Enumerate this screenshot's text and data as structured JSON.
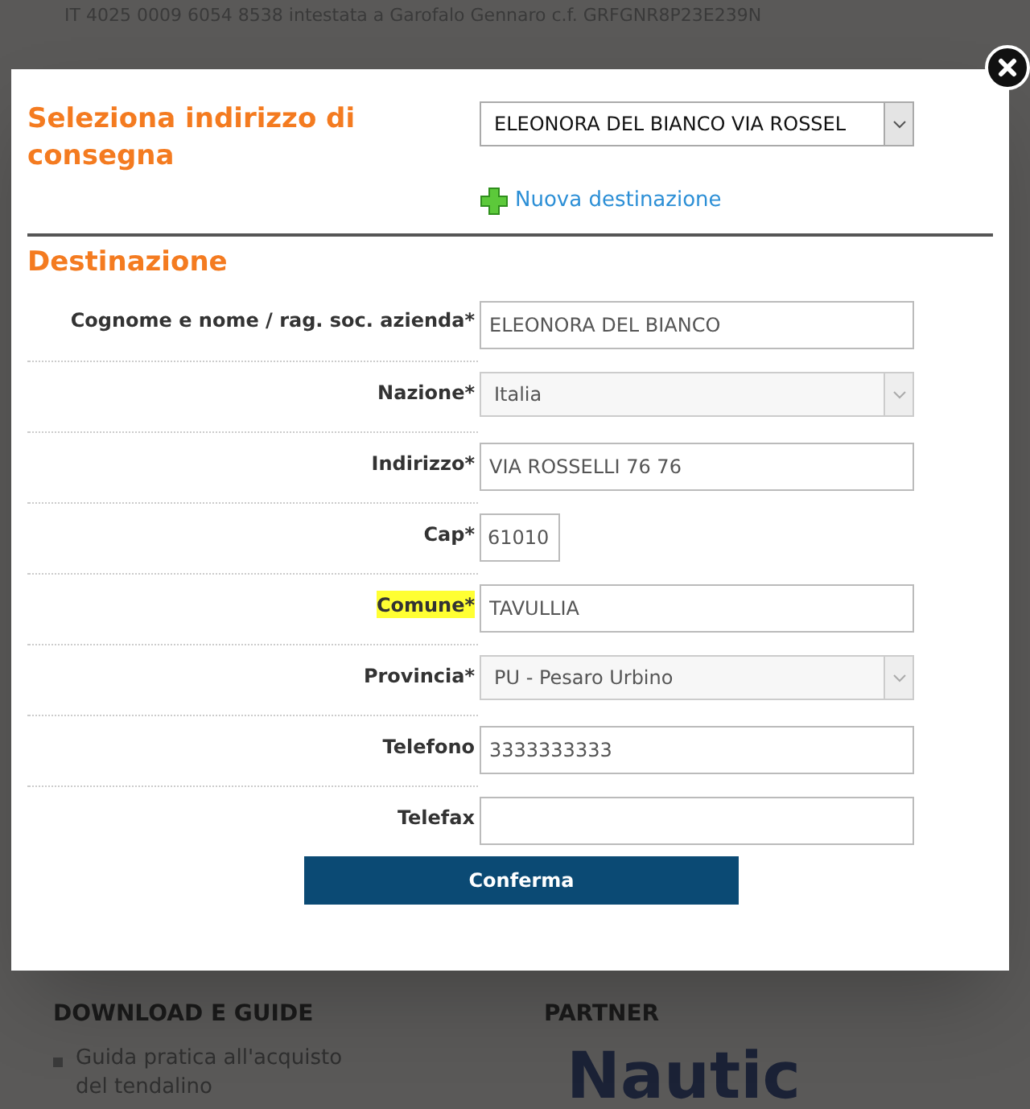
{
  "background": {
    "top_text": "IT 4025 0009 6054 8538 intestata a Garofalo Gennaro c.f. GRFGNR8P23E239N",
    "footer": [
      {
        "heading": "DOWNLOAD E GUIDE",
        "items": [
          "Guida pratica all'acquisto del tendalino"
        ]
      },
      {
        "heading": "PARTNER"
      }
    ],
    "partner_logo": "Nautic"
  },
  "modal": {
    "select_label": "Seleziona indirizzo di consegna",
    "address_select": {
      "value": "ELEONORA DEL BIANCO VIA ROSSEL"
    },
    "new_destination_link": "Nuova destinazione",
    "section_title": "Destinazione",
    "fields": [
      {
        "label": "Cognome e nome / rag. soc. azienda*",
        "kind": "text",
        "value": "ELEONORA DEL BIANCO",
        "highlighted": false
      },
      {
        "label": "Nazione*",
        "kind": "select",
        "value": "Italia",
        "highlighted": false
      },
      {
        "label": "Indirizzo*",
        "kind": "text",
        "value": "VIA ROSSELLI 76 76",
        "highlighted": false
      },
      {
        "label": "Cap*",
        "kind": "short",
        "value": "61010",
        "highlighted": false
      },
      {
        "label": "Comune*",
        "kind": "text",
        "value": "TAVULLIA",
        "highlighted": true
      },
      {
        "label": "Provincia*",
        "kind": "select",
        "value": "PU - Pesaro Urbino",
        "highlighted": false
      },
      {
        "label": "Telefono",
        "kind": "text",
        "value": "3333333333",
        "highlighted": false
      },
      {
        "label": "Telefax",
        "kind": "text",
        "highlighted": false
      }
    ],
    "confirm_button": "Conferma"
  }
}
